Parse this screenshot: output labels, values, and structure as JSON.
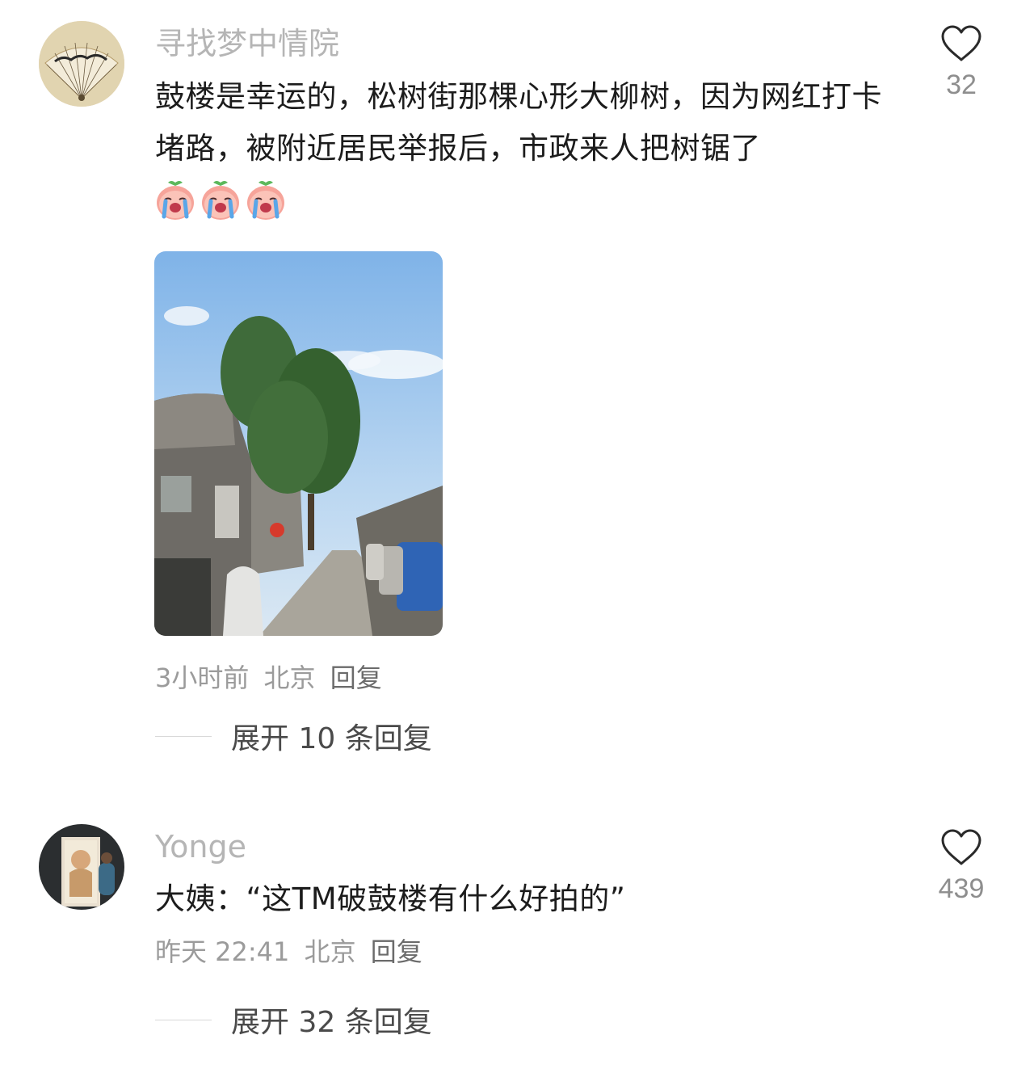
{
  "comments": [
    {
      "username": "寻找梦中情院",
      "text": "鼓楼是幸运的，松树街那棵心形大柳树，因为网红打卡堵路，被附近居民举报后，市政来人把树锯了",
      "emoji_icons": [
        "crying-peach-emoji",
        "crying-peach-emoji",
        "crying-peach-emoji"
      ],
      "has_photo": true,
      "time": "3小时前",
      "location": "北京",
      "reply_label": "回复",
      "likes": "32",
      "expand_label": "展开 10 条回复"
    },
    {
      "username": "Yonge",
      "text": "大姨：“这TM破鼓楼有什么好拍的”",
      "time": "昨天 22:41",
      "location": "北京",
      "reply_label": "回复",
      "likes": "439",
      "expand_label": "展开 32 条回复"
    }
  ],
  "icons": {
    "like": "heart-outline-icon"
  }
}
